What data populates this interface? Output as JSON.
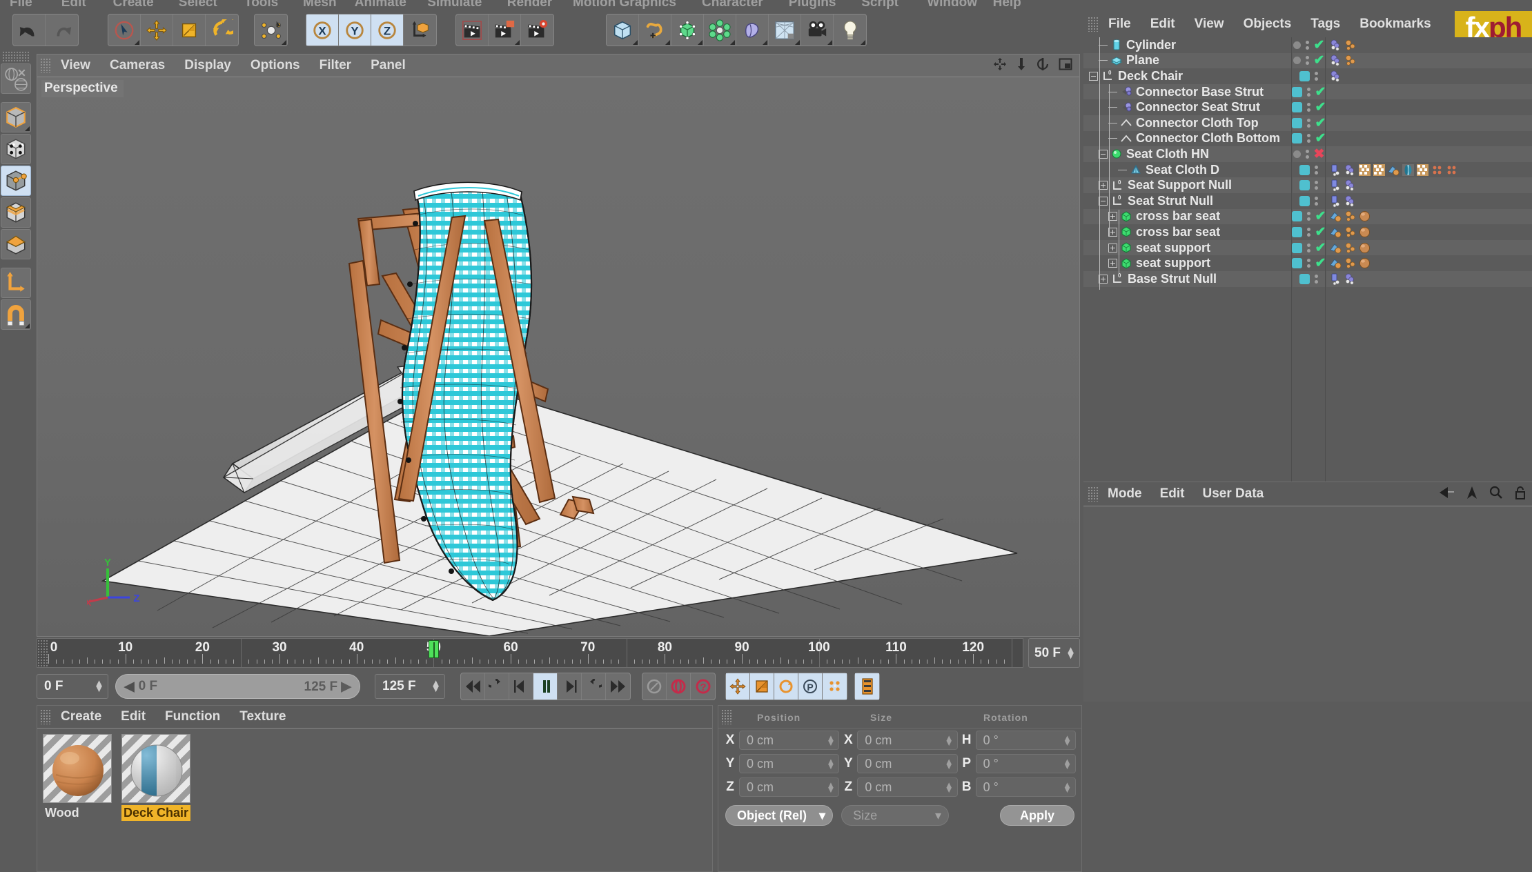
{
  "app": {
    "top_menu": [
      "File",
      "Edit",
      "Create",
      "Select",
      "Tools",
      "Mesh",
      "Animate",
      "Simulate",
      "Render",
      "Motion Graphics",
      "Character",
      "Plugins",
      "Script",
      "Window",
      "Help"
    ]
  },
  "toolbar": {
    "groups": [
      {
        "name": "history",
        "buttons": [
          {
            "name": "undo-button",
            "icon": "undo-icon",
            "selected": false,
            "corner": false
          },
          {
            "name": "redo-button",
            "icon": "redo-icon",
            "selected": false,
            "corner": false
          }
        ]
      },
      {
        "name": "tools",
        "buttons": [
          {
            "name": "live-selection-button",
            "icon": "live-selection-icon",
            "selected": false,
            "corner": true
          },
          {
            "name": "move-button",
            "icon": "move-icon",
            "selected": false,
            "corner": false
          },
          {
            "name": "scale-button",
            "icon": "scale-icon",
            "selected": false,
            "corner": false
          },
          {
            "name": "rotate-button",
            "icon": "rotate-icon",
            "selected": false,
            "corner": false
          }
        ]
      },
      {
        "name": "workplane",
        "buttons": [
          {
            "name": "workplane-button",
            "icon": "workplane-icon",
            "selected": false,
            "corner": true
          }
        ]
      },
      {
        "name": "axis-locks",
        "buttons": [
          {
            "name": "lock-x-button",
            "icon": "axis-x-icon",
            "selected": true,
            "corner": false
          },
          {
            "name": "lock-y-button",
            "icon": "axis-y-icon",
            "selected": true,
            "corner": false
          },
          {
            "name": "lock-z-button",
            "icon": "axis-z-icon",
            "selected": true,
            "corner": false
          },
          {
            "name": "coordinate-system-button",
            "icon": "world-object-axis-icon",
            "selected": false,
            "corner": false
          }
        ]
      },
      {
        "name": "render",
        "buttons": [
          {
            "name": "render-view-button",
            "icon": "render-view-icon",
            "selected": false,
            "corner": false
          },
          {
            "name": "render-region-button",
            "icon": "render-region-icon",
            "selected": false,
            "corner": true
          },
          {
            "name": "render-settings-button",
            "icon": "render-settings-icon",
            "selected": false,
            "corner": false
          }
        ]
      },
      {
        "name": "primitives",
        "buttons": [
          {
            "name": "add-cube-button",
            "icon": "cube-icon",
            "selected": false,
            "corner": true
          },
          {
            "name": "add-spline-button",
            "icon": "spline-pen-icon",
            "selected": false,
            "corner": true
          },
          {
            "name": "add-generator-button",
            "icon": "generator-icon",
            "selected": false,
            "corner": true
          },
          {
            "name": "add-deformer-button",
            "icon": "deformer-icon",
            "selected": false,
            "corner": true
          },
          {
            "name": "add-scene-object-button",
            "icon": "scene-blob-icon",
            "selected": false,
            "corner": true
          },
          {
            "name": "add-environment-button",
            "icon": "environment-sky-icon",
            "selected": false,
            "corner": true
          },
          {
            "name": "add-camera-button",
            "icon": "camera-icon",
            "selected": false,
            "corner": true
          },
          {
            "name": "add-light-button",
            "icon": "light-bulb-icon",
            "selected": false,
            "corner": true
          }
        ]
      }
    ]
  },
  "left_palette": {
    "buttons": [
      {
        "name": "tool-texture-axis-button",
        "icon": "globe-texture-icon",
        "selected": false,
        "corner": false
      },
      {
        "name": "tool-model-mode-button",
        "icon": "model-cube-icon",
        "selected": false,
        "corner": true
      },
      {
        "name": "tool-points-mode-button",
        "icon": "points-cube-icon",
        "selected": false,
        "corner": false
      },
      {
        "name": "tool-edges-mode-button",
        "icon": "edges-cube-icon",
        "selected": true,
        "corner": false
      },
      {
        "name": "tool-polygons-mode-button",
        "icon": "polygons-cube-icon",
        "selected": false,
        "corner": false
      },
      {
        "name": "tool-object-axis-button",
        "icon": "axis-cube-icon",
        "selected": false,
        "corner": false
      },
      {
        "name": "tool-world-axis-button",
        "icon": "l-axis-icon",
        "selected": false,
        "corner": false
      },
      {
        "name": "tool-snap-button",
        "icon": "magnet-icon",
        "selected": false,
        "corner": true
      }
    ]
  },
  "viewport": {
    "menu": [
      "View",
      "Cameras",
      "Display",
      "Options",
      "Filter",
      "Panel"
    ],
    "label": "Perspective",
    "axis": {
      "x": "X",
      "y": "Y",
      "z": "Z"
    },
    "right_icons": [
      "move-view-icon",
      "scale-view-icon",
      "rotate-view-icon",
      "maximize-view-icon"
    ]
  },
  "timeline": {
    "labels": [
      "0",
      "10",
      "20",
      "30",
      "40",
      "50",
      "60",
      "70",
      "80",
      "90",
      "100",
      "110",
      "120"
    ],
    "label_values": [
      0,
      10,
      20,
      30,
      40,
      50,
      60,
      70,
      80,
      90,
      100,
      110,
      120
    ],
    "playhead_frame": 50,
    "max_frame": 125,
    "end_field": "50 F",
    "current_frame_field": "0 F",
    "range_start": "0 F",
    "range_end": "125 F",
    "preview_end": "125 F",
    "transport": [
      {
        "name": "go-to-start-button",
        "icon": "skip-start-icon",
        "lit": false
      },
      {
        "name": "play-backwards-loop-button",
        "icon": "loop-back-icon",
        "lit": false
      },
      {
        "name": "step-back-button",
        "icon": "step-back-icon",
        "lit": false
      },
      {
        "name": "play-button",
        "icon": "play-pause-icon",
        "lit": true
      },
      {
        "name": "step-forward-button",
        "icon": "step-forward-icon",
        "lit": false
      },
      {
        "name": "play-forward-loop-button",
        "icon": "loop-forward-icon",
        "lit": false
      },
      {
        "name": "go-to-end-button",
        "icon": "skip-end-icon",
        "lit": false
      }
    ],
    "keyframe_tools": [
      {
        "name": "record-active-objects-button",
        "icon": "key-record-icon",
        "lit": false
      },
      {
        "name": "autokeying-button",
        "icon": "autokey-icon",
        "lit": false
      },
      {
        "name": "keyframe-selection-button",
        "icon": "key-question-icon",
        "lit": false
      }
    ],
    "key_param_tools": [
      {
        "name": "key-position-button",
        "icon": "position-key-icon",
        "lit": true
      },
      {
        "name": "key-scale-button",
        "icon": "scale-key-icon",
        "lit": true
      },
      {
        "name": "key-rotation-button",
        "icon": "rotation-key-icon",
        "lit": true
      },
      {
        "name": "key-parameter-button",
        "icon": "param-key-icon",
        "lit": true
      },
      {
        "name": "key-pla-button",
        "icon": "pla-key-icon",
        "lit": true
      }
    ],
    "extra_tool": {
      "name": "dope-sheet-button",
      "icon": "dope-sheet-icon",
      "lit": true
    }
  },
  "material_manager": {
    "menu": [
      "Create",
      "Edit",
      "Function",
      "Texture"
    ],
    "materials": [
      {
        "name": "Wood",
        "selected": false,
        "type": "wood-sphere"
      },
      {
        "name": "Deck Chair",
        "selected": true,
        "type": "stripe-sphere"
      }
    ]
  },
  "coordinates": {
    "headers": [
      "Position",
      "Size",
      "Rotation"
    ],
    "rows": [
      {
        "label_a": "X",
        "value_a": "0 cm",
        "label_b": "X",
        "value_b": "0 cm",
        "label_c": "H",
        "value_c": "0 °"
      },
      {
        "label_a": "Y",
        "value_a": "0 cm",
        "label_b": "Y",
        "value_b": "0 cm",
        "label_c": "P",
        "value_c": "0 °"
      },
      {
        "label_a": "Z",
        "value_a": "0 cm",
        "label_b": "Z",
        "value_b": "0 cm",
        "label_c": "B",
        "value_c": "0 °"
      }
    ],
    "mode_dropdown": "Object (Rel)",
    "size_dropdown": "Size",
    "apply_button": "Apply"
  },
  "object_manager": {
    "menu": [
      "File",
      "Edit",
      "View",
      "Objects",
      "Tags",
      "Bookmarks"
    ],
    "logo_text_a": "fx",
    "logo_text_b": "ph",
    "rows": [
      {
        "label": "Cylinder",
        "depth": 1,
        "icon": "cylinder-icon",
        "expander": "none",
        "vis_dot": true,
        "enabled": "check",
        "tags": [
          "deformer-tag",
          "material-tag"
        ]
      },
      {
        "label": "Plane",
        "depth": 1,
        "icon": "plane-icon",
        "expander": "none",
        "vis_dot": true,
        "enabled": "check",
        "tags": [
          "deformer-tag",
          "material-tag"
        ]
      },
      {
        "label": "Deck Chair",
        "depth": 0,
        "icon": "null-icon",
        "expander": "minus",
        "vis_dot": false,
        "enabled": "none",
        "tags": [
          "deformer-tag"
        ]
      },
      {
        "label": "Connector Base Strut",
        "depth": 2,
        "icon": "connector-icon",
        "expander": "none",
        "vis_dot": false,
        "enabled": "check",
        "tags": []
      },
      {
        "label": "Connector Seat Strut",
        "depth": 2,
        "icon": "connector-icon",
        "expander": "none",
        "vis_dot": false,
        "enabled": "check",
        "tags": []
      },
      {
        "label": "Connector Cloth Top",
        "depth": 2,
        "icon": "cloth-link-icon",
        "expander": "none",
        "vis_dot": false,
        "enabled": "check",
        "tags": []
      },
      {
        "label": "Connector Cloth Bottom",
        "depth": 2,
        "icon": "cloth-link-icon",
        "expander": "none",
        "vis_dot": false,
        "enabled": "check",
        "tags": []
      },
      {
        "label": "Seat Cloth HN",
        "depth": 1,
        "icon": "hair-null-icon",
        "expander": "minus",
        "vis_dot": true,
        "enabled": "x",
        "tags": []
      },
      {
        "label": "Seat Cloth D",
        "depth": 3,
        "icon": "cloth-icon",
        "expander": "none",
        "vis_dot": false,
        "enabled": "none",
        "tags": [
          "blue-tag",
          "deformer-tag",
          "checker-tag",
          "checker-tag",
          "uv-tag",
          "cloth-tag",
          "checker-tag",
          "dots-tag",
          "dots-tag"
        ]
      },
      {
        "label": "Seat Support Null",
        "depth": 1,
        "icon": "null-icon",
        "expander": "plus",
        "vis_dot": false,
        "enabled": "none",
        "tags": [
          "blue-tag",
          "deformer-tag"
        ]
      },
      {
        "label": "Seat Strut Null",
        "depth": 1,
        "icon": "null-icon",
        "expander": "minus",
        "vis_dot": false,
        "enabled": "none",
        "tags": [
          "blue-tag",
          "deformer-tag"
        ]
      },
      {
        "label": "cross bar seat",
        "depth": 2,
        "icon": "mesh-icon",
        "expander": "plus",
        "vis_dot": false,
        "enabled": "check",
        "tags": [
          "uv-blue-tag",
          "material-tag",
          "sphere-tag"
        ]
      },
      {
        "label": "cross bar seat",
        "depth": 2,
        "icon": "mesh-icon",
        "expander": "plus",
        "vis_dot": false,
        "enabled": "check",
        "tags": [
          "uv-blue-tag",
          "material-tag",
          "sphere-tag"
        ]
      },
      {
        "label": "seat support",
        "depth": 2,
        "icon": "mesh-icon",
        "expander": "plus",
        "vis_dot": false,
        "enabled": "check",
        "tags": [
          "uv-blue-tag",
          "material-tag",
          "sphere-tag"
        ]
      },
      {
        "label": "seat support",
        "depth": 2,
        "icon": "mesh-icon",
        "expander": "plus",
        "vis_dot": false,
        "enabled": "check",
        "tags": [
          "uv-blue-tag",
          "material-tag",
          "sphere-tag"
        ]
      },
      {
        "label": "Base Strut Null",
        "depth": 1,
        "icon": "null-icon",
        "expander": "plus",
        "vis_dot": false,
        "enabled": "none",
        "tags": [
          "blue-tag",
          "deformer-tag"
        ]
      }
    ]
  },
  "attribute_manager": {
    "menu": [
      "Mode",
      "Edit",
      "User Data"
    ],
    "right_icons": [
      "back-arrow-icon",
      "forward-arrow-icon",
      "search-icon",
      "lock-icon"
    ]
  },
  "colors": {
    "accent_cyan": "#4fc0cf",
    "accent_orange": "#f0b429",
    "wood_brown": "#c98553",
    "cloth_cyan": "#2ec8d8",
    "check_green": "#3de08c",
    "x_red": "#e8455a",
    "panel_bg": "#5b5b5b",
    "viewport_bg": "#6b6b6b",
    "selected_blue": "#cfe0f2",
    "logo_yellow": "#d8b31a",
    "logo_red": "#9e1b32",
    "playhead_green": "#4ee05a"
  }
}
